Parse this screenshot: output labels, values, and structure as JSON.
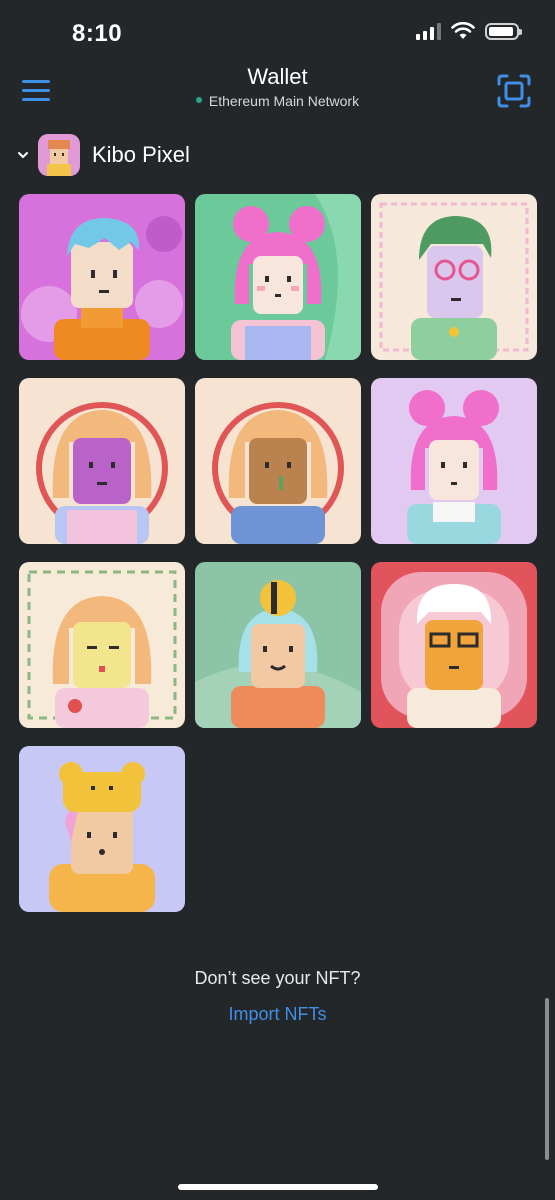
{
  "status": {
    "time": "8:10",
    "icons": [
      "cellular-signal-icon",
      "wifi-icon",
      "battery-icon"
    ],
    "battery_level": 0.8
  },
  "nav": {
    "title": "Wallet",
    "network": "Ethereum Main Network",
    "network_dot_color": "#28a68a",
    "accent_color": "#3f8fe6",
    "icons": [
      "hamburger-menu-icon",
      "scan-icon"
    ]
  },
  "collection": {
    "name": "Kibo Pixel",
    "expanded_icon": "chevron-down-icon",
    "nft_count": 10
  },
  "footer": {
    "question": "Don’t see your NFT?",
    "import_link": "Import NFTs"
  }
}
